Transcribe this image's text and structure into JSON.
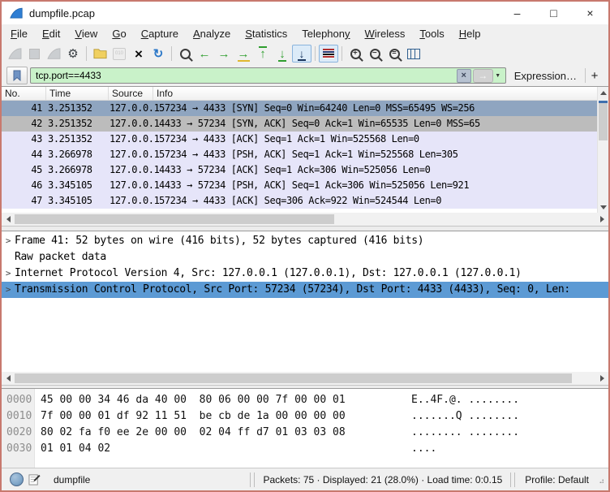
{
  "window": {
    "title": "dumpfile.pcap",
    "controls": {
      "minimize": "–",
      "maximize": "□",
      "close": "×"
    }
  },
  "menu": {
    "items": [
      {
        "label": "File",
        "accel": 0
      },
      {
        "label": "Edit",
        "accel": 0
      },
      {
        "label": "View",
        "accel": 0
      },
      {
        "label": "Go",
        "accel": 0
      },
      {
        "label": "Capture",
        "accel": 0
      },
      {
        "label": "Analyze",
        "accel": 0
      },
      {
        "label": "Statistics",
        "accel": 0
      },
      {
        "label": "Telephony",
        "accel": 8
      },
      {
        "label": "Wireless",
        "accel": 0
      },
      {
        "label": "Tools",
        "accel": 0
      },
      {
        "label": "Help",
        "accel": 0
      }
    ]
  },
  "toolbar": {
    "items": [
      {
        "name": "start-capture-icon",
        "state": "disabled"
      },
      {
        "name": "stop-capture-icon",
        "state": "disabled"
      },
      {
        "name": "restart-capture-icon",
        "state": "disabled"
      },
      {
        "name": "capture-options-icon",
        "state": "normal"
      },
      {
        "name": "separator"
      },
      {
        "name": "open-file-icon",
        "state": "normal"
      },
      {
        "name": "save-file-icon",
        "state": "disabled"
      },
      {
        "name": "close-file-icon",
        "state": "normal"
      },
      {
        "name": "reload-icon",
        "state": "normal"
      },
      {
        "name": "separator"
      },
      {
        "name": "find-packet-icon",
        "state": "normal"
      },
      {
        "name": "go-back-icon",
        "state": "normal"
      },
      {
        "name": "go-forward-icon",
        "state": "normal"
      },
      {
        "name": "go-to-packet-icon",
        "state": "normal"
      },
      {
        "name": "go-to-top-icon",
        "state": "normal"
      },
      {
        "name": "go-to-bottom-icon",
        "state": "normal"
      },
      {
        "name": "auto-scroll-icon",
        "state": "active"
      },
      {
        "name": "separator"
      },
      {
        "name": "colorize-icon",
        "state": "active"
      },
      {
        "name": "separator"
      },
      {
        "name": "zoom-in-icon",
        "state": "normal"
      },
      {
        "name": "zoom-out-icon",
        "state": "normal"
      },
      {
        "name": "zoom-reset-icon",
        "state": "normal"
      },
      {
        "name": "resize-columns-icon",
        "state": "normal"
      }
    ]
  },
  "filter": {
    "value": "tcp.port==4433",
    "clear_label": "×",
    "apply_label": "→",
    "dropdown_label": "▼",
    "expression_label": "Expression…",
    "add_label": "+",
    "valid_color": "#c9f2c9"
  },
  "packet_list": {
    "columns": [
      "No.",
      "Time",
      "Source",
      "Info"
    ],
    "rows": [
      {
        "no": "41",
        "time": "3.251352",
        "source": "127.0.0.1",
        "info": "57234 → 4433 [SYN] Seq=0 Win=64240 Len=0 MSS=65495 WS=256",
        "state": "selected"
      },
      {
        "no": "42",
        "time": "3.251352",
        "source": "127.0.0.1",
        "info": "4433 → 57234 [SYN, ACK] Seq=0 Ack=1 Win=65535 Len=0 MSS=65",
        "state": "handshake"
      },
      {
        "no": "43",
        "time": "3.251352",
        "source": "127.0.0.1",
        "info": "57234 → 4433 [ACK] Seq=1 Ack=1 Win=525568 Len=0",
        "state": "tcp"
      },
      {
        "no": "44",
        "time": "3.266978",
        "source": "127.0.0.1",
        "info": "57234 → 4433 [PSH, ACK] Seq=1 Ack=1 Win=525568 Len=305",
        "state": "tcp"
      },
      {
        "no": "45",
        "time": "3.266978",
        "source": "127.0.0.1",
        "info": "4433 → 57234 [ACK] Seq=1 Ack=306 Win=525056 Len=0",
        "state": "tcp"
      },
      {
        "no": "46",
        "time": "3.345105",
        "source": "127.0.0.1",
        "info": "4433 → 57234 [PSH, ACK] Seq=1 Ack=306 Win=525056 Len=921",
        "state": "tcp"
      },
      {
        "no": "47",
        "time": "3.345105",
        "source": "127.0.0.1",
        "info": "57234 → 4433 [ACK] Seq=306 Ack=922 Win=524544 Len=0",
        "state": "tcp"
      }
    ],
    "colors": {
      "selected_row": "#8fa5c0",
      "handshake_row": "#bcbcbc",
      "tcp_row": "#e6e5f9"
    }
  },
  "details": {
    "lines": [
      {
        "prefix": ">",
        "text": "Frame 41: 52 bytes on wire (416 bits), 52 bytes captured (416 bits)",
        "selected": false
      },
      {
        "prefix": "",
        "text": "Raw packet data",
        "selected": false
      },
      {
        "prefix": ">",
        "text": "Internet Protocol Version 4, Src: 127.0.0.1 (127.0.0.1), Dst: 127.0.0.1 (127.0.0.1)",
        "selected": false
      },
      {
        "prefix": ">",
        "text": "Transmission Control Protocol, Src Port: 57234 (57234), Dst Port: 4433 (4433), Seq: 0, Len:",
        "selected": true
      }
    ],
    "selected_color": "#5c9ad4"
  },
  "hex": {
    "lines": [
      {
        "offset": "0000",
        "bytes": "45 00 00 34 46 da 40 00  80 06 00 00 7f 00 00 01",
        "ascii": "E..4F.@. ........"
      },
      {
        "offset": "0010",
        "bytes": "7f 00 00 01 df 92 11 51  be cb de 1a 00 00 00 00",
        "ascii": ".......Q ........"
      },
      {
        "offset": "0020",
        "bytes": "80 02 fa f0 ee 2e 00 00  02 04 ff d7 01 03 03 08",
        "ascii": "........ ........"
      },
      {
        "offset": "0030",
        "bytes": "01 01 04 02",
        "ascii": "...."
      }
    ]
  },
  "status": {
    "file": "dumpfile",
    "stats": "Packets: 75 · Displayed: 21 (28.0%) ·  Load time: 0:0.15",
    "profile": "Profile: Default"
  }
}
